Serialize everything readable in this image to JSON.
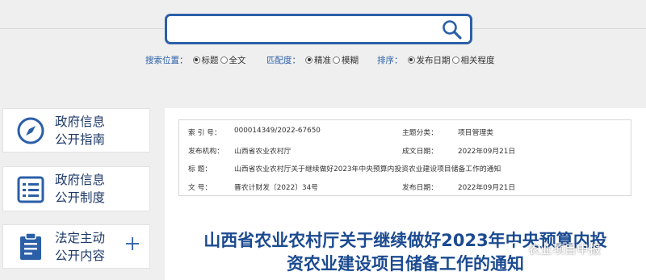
{
  "search": {
    "placeholder": "",
    "value": ""
  },
  "options": {
    "scope": {
      "label": "搜索位置：",
      "choices": [
        "标题",
        "全文"
      ],
      "selected": "标题"
    },
    "match": {
      "label": "匹配度：",
      "choices": [
        "精准",
        "模糊"
      ],
      "selected": "精准"
    },
    "sort": {
      "label": "排序：",
      "choices": [
        "发布日期",
        "相关程度"
      ],
      "selected": "发布日期"
    }
  },
  "sidebar": {
    "items": [
      {
        "line1": "政府信息",
        "line2": "公开指南",
        "icon": "compass-icon"
      },
      {
        "line1": "政府信息",
        "line2": "公开制度",
        "icon": "list-icon"
      },
      {
        "line1": "法定主动",
        "line2": "公开内容",
        "icon": "clipboard-icon",
        "expand": "+"
      }
    ]
  },
  "meta": {
    "index_label": "索  引 号：",
    "index_value": "000014349/2022-67650",
    "topic_label": "主题分类：",
    "topic_value": "项目管理类",
    "org_label": "发布机构：",
    "org_value": "山西省农业农村厅",
    "made_label": "成文日期：",
    "made_value": "2022年09月21日",
    "title_label": "标      题：",
    "title_value": "山西省农业农村厅关于继续做好2023年中央预算内投资农业建设项目储备工作的通知",
    "docno_label": "文      号：",
    "docno_value": "晋农计财发〔2022〕34号",
    "pub_label": "发布日期：",
    "pub_value": "2022年09月21日"
  },
  "document": {
    "title_line1": "山西省农业农村厅关于继续做好2023年中央预算内投",
    "title_line2": "资农业建设项目储备工作的通知"
  },
  "watermark": {
    "text": "农业项目申报"
  },
  "colors": {
    "brand": "#2b5fa8",
    "title": "#1b4a90",
    "nav_text": "#1f3a68"
  }
}
